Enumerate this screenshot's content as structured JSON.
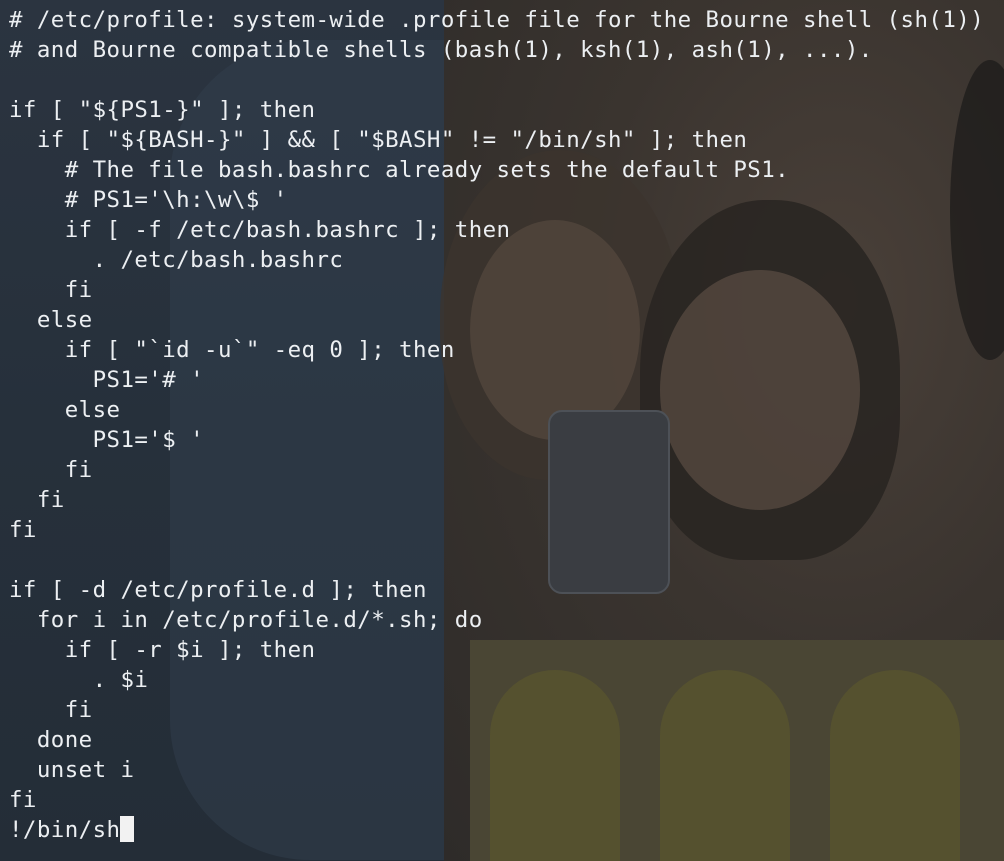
{
  "terminal": {
    "lines": [
      "# /etc/profile: system-wide .profile file for the Bourne shell (sh(1))",
      "# and Bourne compatible shells (bash(1), ksh(1), ash(1), ...).",
      "",
      "if [ \"${PS1-}\" ]; then",
      "  if [ \"${BASH-}\" ] && [ \"$BASH\" != \"/bin/sh\" ]; then",
      "    # The file bash.bashrc already sets the default PS1.",
      "    # PS1='\\h:\\w\\$ '",
      "    if [ -f /etc/bash.bashrc ]; then",
      "      . /etc/bash.bashrc",
      "    fi",
      "  else",
      "    if [ \"`id -u`\" -eq 0 ]; then",
      "      PS1='# '",
      "    else",
      "      PS1='$ '",
      "    fi",
      "  fi",
      "fi",
      "",
      "if [ -d /etc/profile.d ]; then",
      "  for i in /etc/profile.d/*.sh; do",
      "    if [ -r $i ]; then",
      "      . $i",
      "    fi",
      "  done",
      "  unset i",
      "fi"
    ],
    "prompt_input": "!/bin/sh"
  }
}
